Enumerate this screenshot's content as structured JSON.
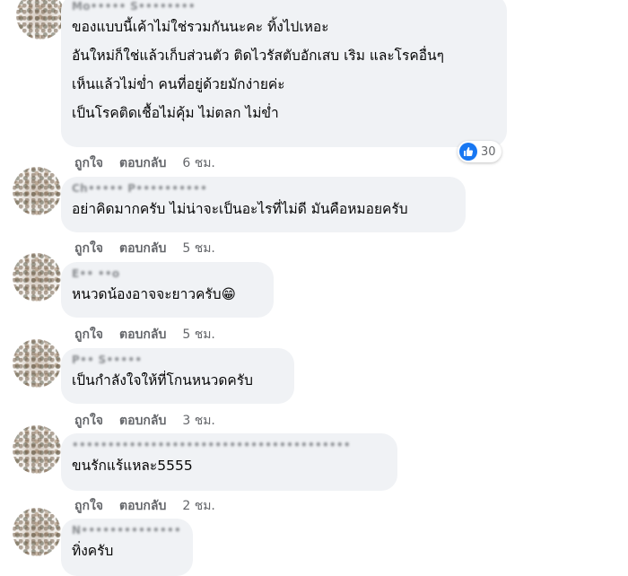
{
  "comments": [
    {
      "author": "Mo••••• S••••••••",
      "lines": [
        "ของแบบนี้เค้าไม่ใช่รวมกันนะคะ ทิ้งไปเหอะ",
        "อันใหม่ก็ใช่แล้วเก็บส่วนตัว ติดไวรัสตับอักเสบ เริม และโรคอื่นๆ",
        "เห็นแล้วไม่ข่ำ คนที่อยู่ด้วยมักง่ายค่ะ",
        "เป็นโรคติดเชื้อไม่คุ้ม ไม่ตลก ไม่ข่ำ"
      ],
      "like_label": "ถูกใจ",
      "reply_label": "ตอบกลับ",
      "time": "6 ชม.",
      "reaction_count": "30"
    },
    {
      "author": "Ch••••• P••••••••••",
      "lines": [
        "อย่าคิดมากครับ ไม่น่าจะเป็นอะไรที่ไม่ดี มันคือหมอยครับ"
      ],
      "like_label": "ถูกใจ",
      "reply_label": "ตอบกลับ",
      "time": "5 ชม."
    },
    {
      "author": "E•• ••o",
      "lines": [
        "หนวดน้องอาจจะยาวครับ😁"
      ],
      "like_label": "ถูกใจ",
      "reply_label": "ตอบกลับ",
      "time": "5 ชม."
    },
    {
      "author": "P•• S•••••",
      "lines": [
        "เป็นกำลังใจให้ที่โกนหนวดครับ"
      ],
      "like_label": "ถูกใจ",
      "reply_label": "ตอบกลับ",
      "time": "3 ชม."
    },
    {
      "author": "•••••••••••••••••••••••••••••••••••••••",
      "lines": [
        "ขนรักแร้แหละ5555"
      ],
      "like_label": "ถูกใจ",
      "reply_label": "ตอบกลับ",
      "time": "2 ชม."
    },
    {
      "author": "N••••••••••••••",
      "lines": [
        "ทิ่งครับ"
      ]
    }
  ]
}
